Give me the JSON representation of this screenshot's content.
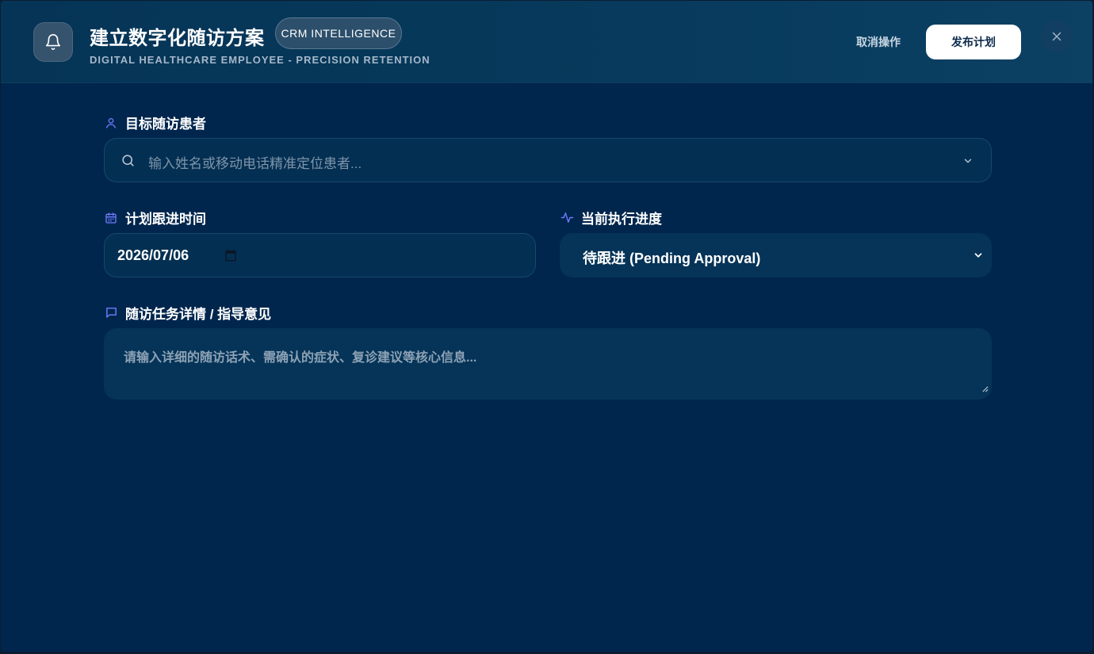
{
  "header": {
    "title": "建立数字化随访方案",
    "badge": "CRM INTELLIGENCE",
    "subtitle": "DIGITAL HEALTHCARE EMPLOYEE - PRECISION RETENTION",
    "cancel_label": "取消操作",
    "publish_label": "发布计划",
    "icon": "bell-icon",
    "close_icon": "close-icon"
  },
  "form": {
    "patient": {
      "label": "目标随访患者",
      "placeholder": "输入姓名或移动电话精准定位患者...",
      "icon": "user-icon"
    },
    "date": {
      "label": "计划跟进时间",
      "value": "2026/07/06",
      "icon": "calendar-icon"
    },
    "status": {
      "label": "当前执行进度",
      "value": "待跟进 (Pending Approval)",
      "icon": "activity-icon"
    },
    "notes": {
      "label": "随访任务详情 / 指导意见",
      "placeholder": "请输入详细的随访话术、需确认的症状、复诊建议等核心信息...",
      "icon": "message-icon"
    }
  },
  "colors": {
    "background": "#00264d",
    "header": "#073a5c",
    "accent_icon": "#6e7bff",
    "field": "#032f52",
    "button_primary": "#ffffff"
  }
}
